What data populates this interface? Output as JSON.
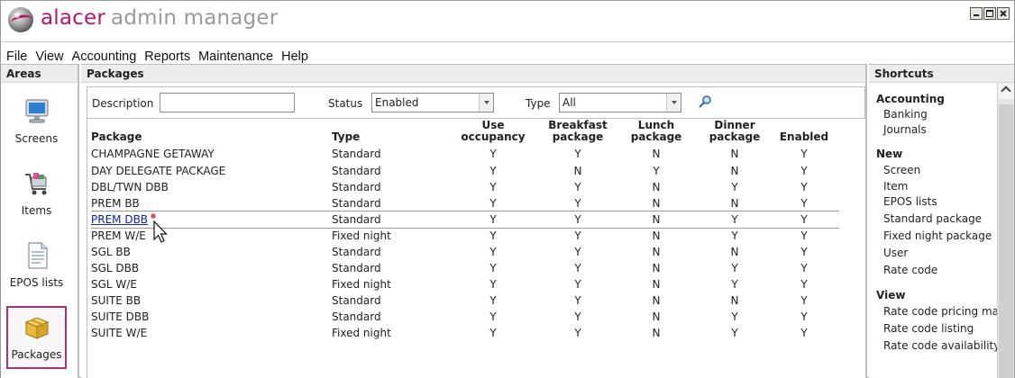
{
  "app": {
    "brand_primary": "alacer",
    "brand_secondary": "admin manager",
    "accent_color": "#b5176a"
  },
  "menu": [
    "File",
    "View",
    "Accounting",
    "Reports",
    "Maintenance",
    "Help"
  ],
  "areas": {
    "title": "Areas",
    "items": [
      {
        "label": "Screens",
        "icon": "monitor-icon"
      },
      {
        "label": "Items",
        "icon": "shopping-cart-icon"
      },
      {
        "label": "EPOS lists",
        "icon": "document-icon"
      },
      {
        "label": "Packages",
        "icon": "package-box-icon",
        "selected": true
      }
    ]
  },
  "packages": {
    "title": "Packages",
    "filters": {
      "description_label": "Description",
      "description_value": "",
      "status_label": "Status",
      "status_value": "Enabled",
      "type_label": "Type",
      "type_value": "All"
    },
    "columns": {
      "package": "Package",
      "type": "Type",
      "use_occupancy": [
        "Use",
        "occupancy"
      ],
      "breakfast": [
        "Breakfast",
        "package"
      ],
      "lunch": [
        "Lunch",
        "package"
      ],
      "dinner": [
        "Dinner",
        "package"
      ],
      "enabled": "Enabled"
    },
    "rows": [
      {
        "name": "CHAMPAGNE GETAWAY",
        "type": "Standard",
        "occ": "Y",
        "bf": "Y",
        "lunch": "N",
        "dinner": "N",
        "enabled": "Y"
      },
      {
        "name": "DAY DELEGATE PACKAGE",
        "type": "Standard",
        "occ": "Y",
        "bf": "N",
        "lunch": "Y",
        "dinner": "N",
        "enabled": "Y"
      },
      {
        "name": "DBL/TWN DBB",
        "type": "Standard",
        "occ": "Y",
        "bf": "Y",
        "lunch": "N",
        "dinner": "Y",
        "enabled": "Y"
      },
      {
        "name": "PREM BB",
        "type": "Standard",
        "occ": "Y",
        "bf": "Y",
        "lunch": "N",
        "dinner": "N",
        "enabled": "Y"
      },
      {
        "name": "PREM DBB",
        "type": "Standard",
        "occ": "Y",
        "bf": "Y",
        "lunch": "N",
        "dinner": "Y",
        "enabled": "Y",
        "selected": true
      },
      {
        "name": "PREM W/E",
        "type": "Fixed night",
        "occ": "Y",
        "bf": "Y",
        "lunch": "N",
        "dinner": "Y",
        "enabled": "Y"
      },
      {
        "name": "SGL BB",
        "type": "Standard",
        "occ": "Y",
        "bf": "Y",
        "lunch": "N",
        "dinner": "N",
        "enabled": "Y"
      },
      {
        "name": "SGL DBB",
        "type": "Standard",
        "occ": "Y",
        "bf": "Y",
        "lunch": "N",
        "dinner": "Y",
        "enabled": "Y"
      },
      {
        "name": "SGL W/E",
        "type": "Fixed night",
        "occ": "Y",
        "bf": "Y",
        "lunch": "N",
        "dinner": "Y",
        "enabled": "Y"
      },
      {
        "name": "SUITE BB",
        "type": "Standard",
        "occ": "Y",
        "bf": "Y",
        "lunch": "N",
        "dinner": "N",
        "enabled": "Y"
      },
      {
        "name": "SUITE DBB",
        "type": "Standard",
        "occ": "Y",
        "bf": "Y",
        "lunch": "N",
        "dinner": "Y",
        "enabled": "Y"
      },
      {
        "name": "SUITE W/E",
        "type": "Fixed night",
        "occ": "Y",
        "bf": "Y",
        "lunch": "N",
        "dinner": "Y",
        "enabled": "Y"
      }
    ]
  },
  "shortcuts": {
    "title": "Shortcuts",
    "groups": [
      {
        "title": "Accounting",
        "items": [
          "Banking",
          "Journals"
        ]
      },
      {
        "title": "New",
        "items": [
          "Screen",
          "Item",
          "EPOS lists",
          "Standard package",
          "Fixed night package",
          "User",
          "Rate code"
        ]
      },
      {
        "title": "View",
        "items": [
          "Rate code pricing map",
          "Rate code listing",
          "Rate code availability"
        ]
      }
    ]
  }
}
